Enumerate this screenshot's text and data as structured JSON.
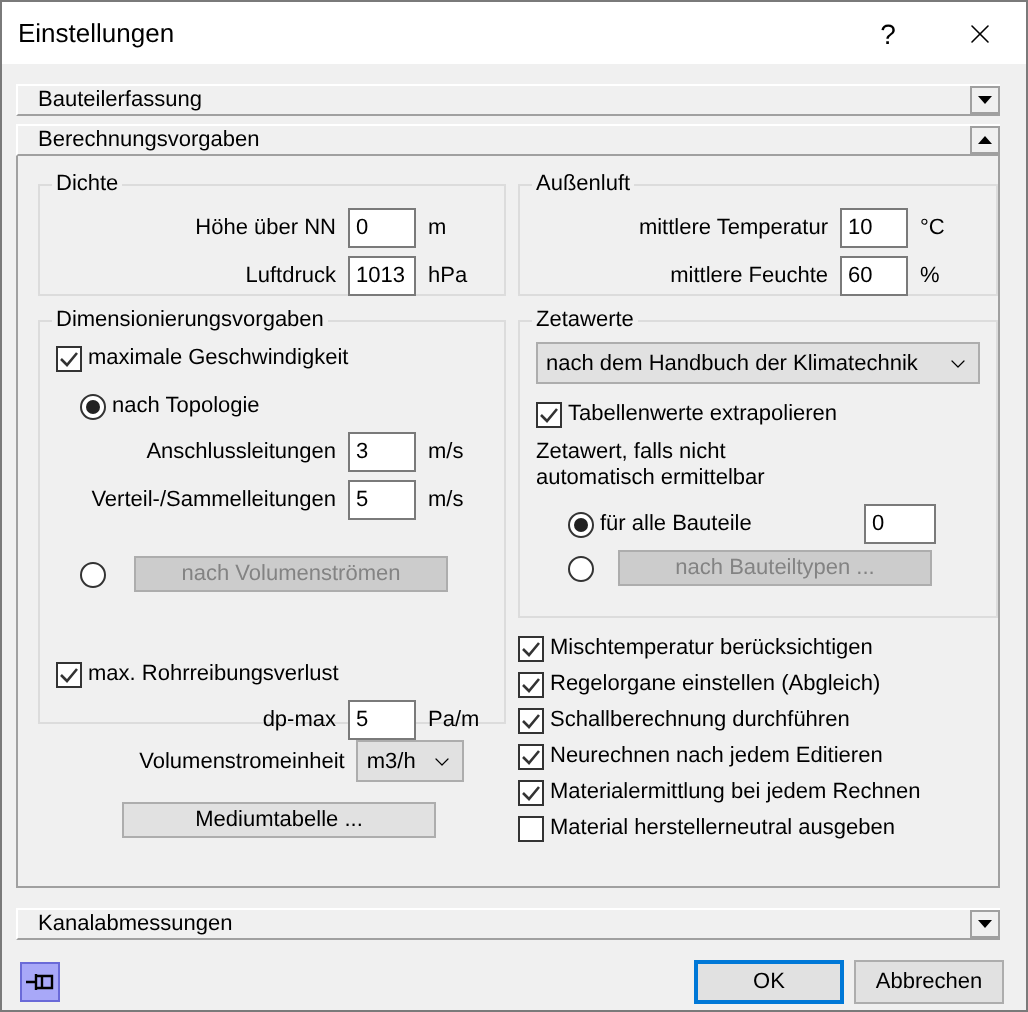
{
  "window": {
    "title": "Einstellungen",
    "help": "?"
  },
  "sections": [
    {
      "title": "Bauteilerfassung",
      "expanded": false
    },
    {
      "title": "Berechnungsvorgaben",
      "expanded": true
    },
    {
      "title": "Kanalabmessungen",
      "expanded": false
    }
  ],
  "dichte": {
    "title": "Dichte",
    "fields": [
      {
        "label": "Höhe über NN",
        "value": "0",
        "unit": "m"
      },
      {
        "label": "Luftdruck",
        "value": "1013",
        "unit": "hPa"
      }
    ]
  },
  "aussenluft": {
    "title": "Außenluft",
    "fields": [
      {
        "label": "mittlere Temperatur",
        "value": "10",
        "unit": "°C"
      },
      {
        "label": "mittlere Feuchte",
        "value": "60",
        "unit": "%"
      }
    ]
  },
  "dimensionierung": {
    "title": "Dimensionierungsvorgaben",
    "max_speed": {
      "label": "maximale Geschwindigkeit",
      "checked": true
    },
    "options": [
      {
        "kind": "fields",
        "label": "nach Topologie",
        "selected": true,
        "fields": [
          {
            "label": "Anschlussleitungen",
            "value": "3",
            "unit": "m/s"
          },
          {
            "label": "Verteil-/Sammelleitungen",
            "value": "5",
            "unit": "m/s"
          }
        ]
      },
      {
        "kind": "button",
        "button": "nach Volumenströmen",
        "selected": false,
        "disabled": true
      }
    ],
    "friction": {
      "label": "max. Rohrreibungsverlust",
      "checked": true,
      "field": {
        "label": "dp-max",
        "value": "5",
        "unit": "Pa/m"
      }
    }
  },
  "volume_unit": {
    "label": "Volumenstromeinheit",
    "value": "m3/h"
  },
  "medium_button": "Mediumtabelle ...",
  "zetawerte": {
    "title": "Zetawerte",
    "source": "nach dem Handbuch der Klimatechnik",
    "extrapolate": {
      "label": "Tabellenwerte extrapolieren",
      "checked": true
    },
    "fallback_label": "Zetawert, falls nicht automatisch ermittelbar",
    "options": [
      {
        "kind": "field",
        "label": "für alle Bauteile",
        "value": "0",
        "selected": true
      },
      {
        "kind": "button",
        "button": "nach Bauteiltypen ...",
        "selected": false,
        "disabled": true
      }
    ]
  },
  "options": [
    {
      "label": "Mischtemperatur berücksichtigen",
      "checked": true
    },
    {
      "label": "Regelorgane einstellen (Abgleich)",
      "checked": true
    },
    {
      "label": "Schallberechnung durchführen",
      "checked": true
    },
    {
      "label": "Neurechnen nach jedem Editieren",
      "checked": true
    },
    {
      "label": "Materialermittlung bei jedem Rechnen",
      "checked": true
    },
    {
      "label": "Material herstellerneutral ausgeben",
      "checked": false
    }
  ],
  "pin": {
    "pressed": true
  },
  "buttons": [
    {
      "label": "OK",
      "default": true
    },
    {
      "label": "Abbrechen",
      "default": false
    }
  ]
}
